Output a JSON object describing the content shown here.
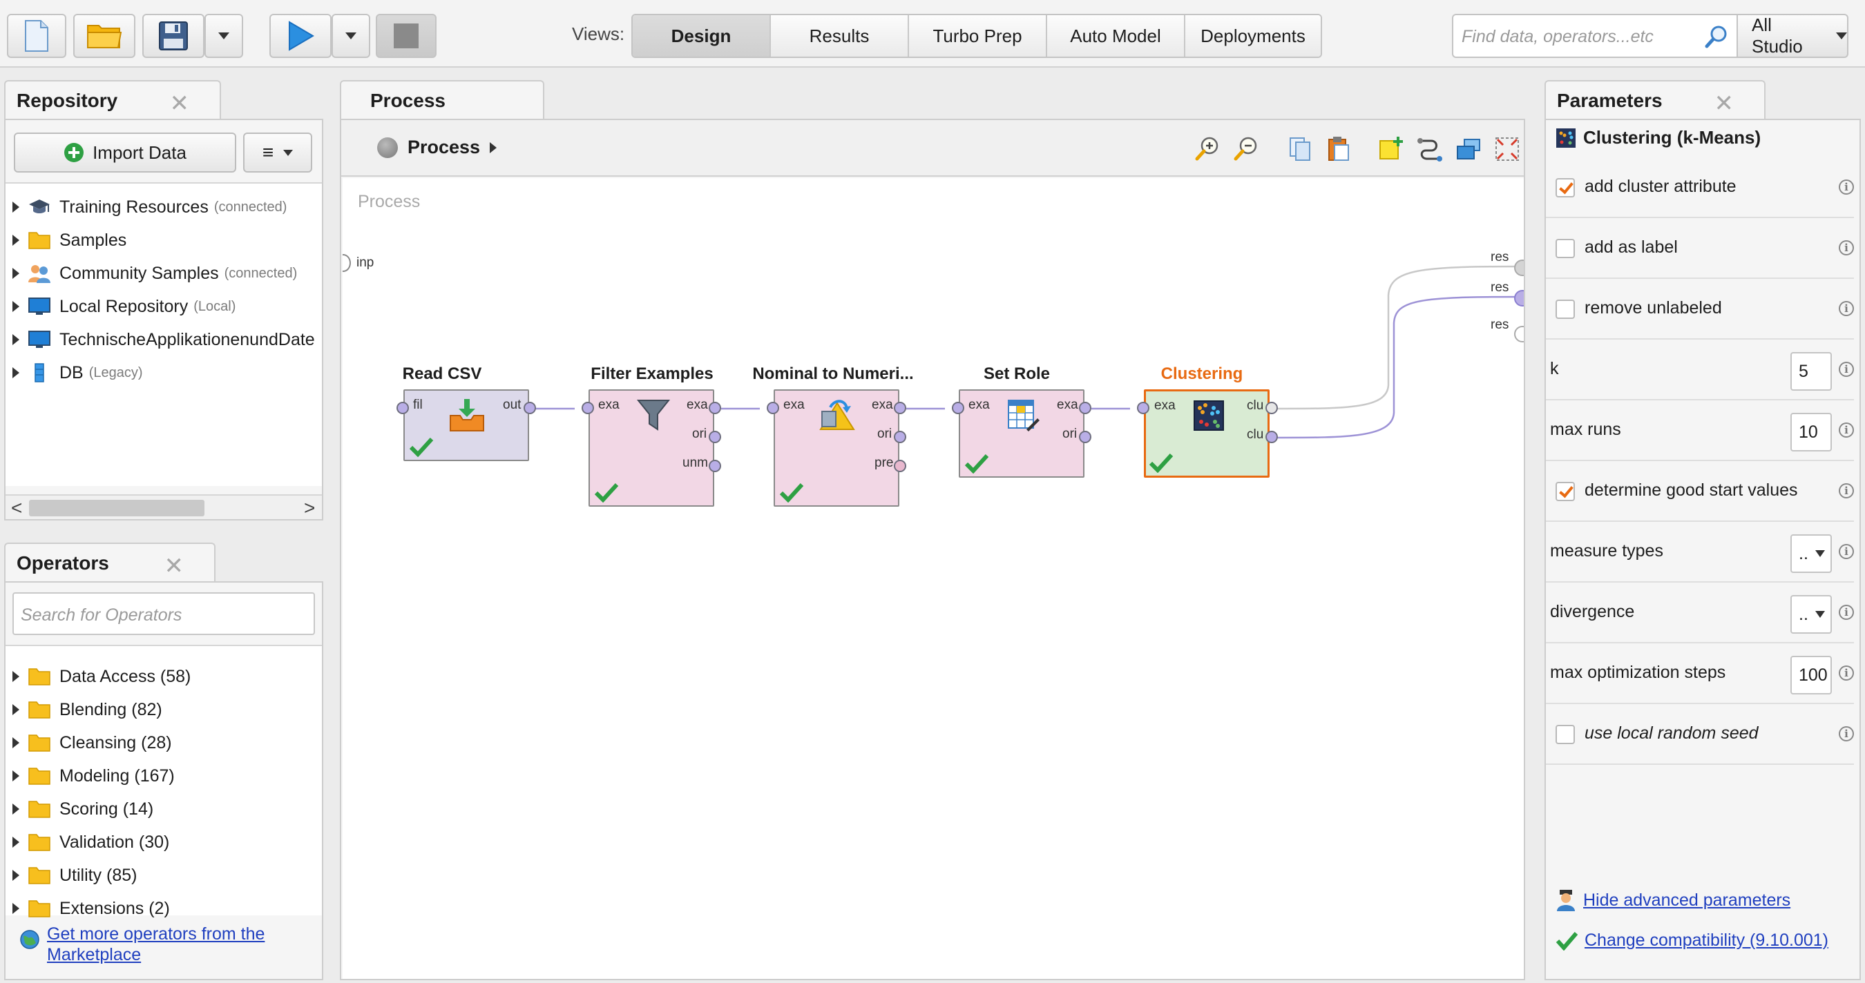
{
  "toolbar": {
    "views_label": "Views:",
    "views": [
      {
        "label": "Design",
        "active": true
      },
      {
        "label": "Results",
        "active": false
      },
      {
        "label": "Turbo Prep",
        "active": false
      },
      {
        "label": "Auto Model",
        "active": false
      },
      {
        "label": "Deployments",
        "active": false
      }
    ],
    "search_placeholder": "Find data, operators...etc",
    "studio_label": "All Studio"
  },
  "repository": {
    "tab_label": "Repository",
    "import_label": "Import Data",
    "items": [
      {
        "label": "Training Resources",
        "sub": "(connected)",
        "icon": "graduation-cap-icon"
      },
      {
        "label": "Samples",
        "sub": "",
        "icon": "folder-icon"
      },
      {
        "label": "Community Samples",
        "sub": "(connected)",
        "icon": "people-icon"
      },
      {
        "label": "Local Repository",
        "sub": "(Local)",
        "icon": "monitor-icon"
      },
      {
        "label": "TechnischeApplikationenundDate",
        "sub": "",
        "icon": "monitor-icon"
      },
      {
        "label": "DB",
        "sub": "(Legacy)",
        "icon": "database-icon"
      }
    ]
  },
  "operators": {
    "tab_label": "Operators",
    "search_placeholder": "Search for Operators",
    "items": [
      "Data Access (58)",
      "Blending (82)",
      "Cleansing (28)",
      "Modeling (167)",
      "Scoring (14)",
      "Validation (30)",
      "Utility (85)",
      "Extensions (2)"
    ],
    "marketplace_link": "Get more operators from the Marketplace"
  },
  "process": {
    "tab_label": "Process",
    "breadcrumb": "Process",
    "canvas_label": "Process",
    "input_port": "inp",
    "result_ports": [
      "res",
      "res",
      "res"
    ],
    "nodes": [
      {
        "title": "Read CSV",
        "in_ports": [
          "fil"
        ],
        "out_ports": [
          "out"
        ],
        "color": "#dcd9ea",
        "selected": false
      },
      {
        "title": "Filter Examples",
        "in_ports": [
          "exa"
        ],
        "out_ports": [
          "exa",
          "ori",
          "unm"
        ],
        "color": "#f2d7e5",
        "selected": false
      },
      {
        "title": "Nominal to Numeri...",
        "in_ports": [
          "exa"
        ],
        "out_ports": [
          "exa",
          "ori",
          "pre"
        ],
        "color": "#f2d7e5",
        "selected": false
      },
      {
        "title": "Set Role",
        "in_ports": [
          "exa"
        ],
        "out_ports": [
          "exa",
          "ori"
        ],
        "color": "#f2d7e5",
        "selected": false
      },
      {
        "title": "Clustering",
        "in_ports": [
          "exa"
        ],
        "out_ports": [
          "clu",
          "clu"
        ],
        "color": "#d9ebd3",
        "selected": true
      }
    ],
    "colors": {
      "selected_title": "#e86a12",
      "port_fill": "#b9aee6",
      "wire": "#9d92d6"
    }
  },
  "parameters": {
    "tab_label": "Parameters",
    "operator_title": "Clustering (k-Means)",
    "rows": [
      {
        "type": "checkbox",
        "label": "add cluster attribute",
        "checked": true
      },
      {
        "type": "checkbox",
        "label": "add as label",
        "checked": false
      },
      {
        "type": "checkbox",
        "label": "remove unlabeled",
        "checked": false
      },
      {
        "type": "number",
        "label": "k",
        "value": "5"
      },
      {
        "type": "number",
        "label": "max runs",
        "value": "10"
      },
      {
        "type": "checkbox",
        "label": "determine good start values",
        "checked": true
      },
      {
        "type": "select",
        "label": "measure types",
        "value": ".."
      },
      {
        "type": "select",
        "label": "divergence",
        "value": ".."
      },
      {
        "type": "number",
        "label": "max optimization steps",
        "value": "100"
      },
      {
        "type": "checkbox",
        "label": "use local random seed",
        "checked": false,
        "italic": true
      }
    ],
    "hide_advanced_link": "Hide advanced parameters",
    "compat_link": "Change compatibility (9.10.001)",
    "accent": "#e86a12"
  }
}
